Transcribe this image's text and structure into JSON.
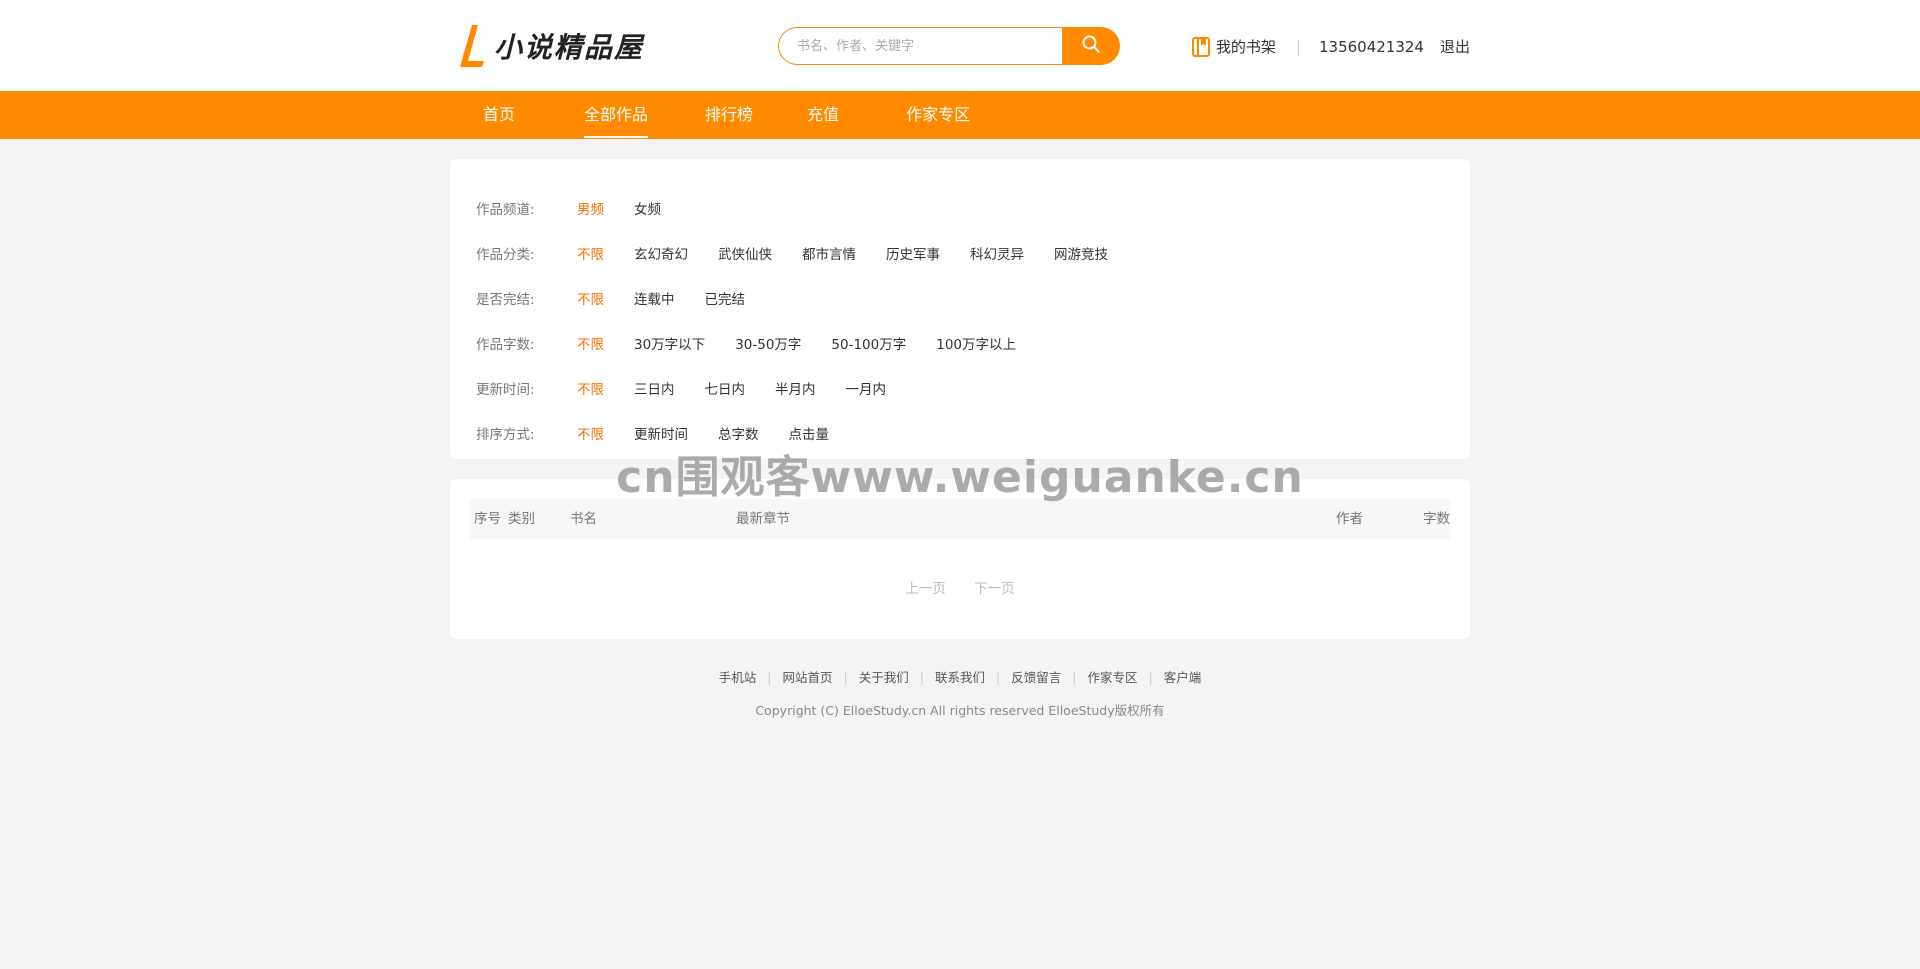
{
  "header": {
    "logo_text": "小说精品屋",
    "search_placeholder": "书名、作者、关键字",
    "bookshelf_label": "我的书架",
    "separator": "|",
    "phone": "13560421324",
    "logout_label": "退出"
  },
  "nav": {
    "items": [
      "首页",
      "全部作品",
      "排行榜",
      "充值",
      "作家专区"
    ],
    "active": "全部作品"
  },
  "filters": [
    {
      "label": "作品频道:",
      "options": [
        "男频",
        "女频"
      ],
      "selected": "男频"
    },
    {
      "label": "作品分类:",
      "options": [
        "不限",
        "玄幻奇幻",
        "武侠仙侠",
        "都市言情",
        "历史军事",
        "科幻灵异",
        "网游竞技"
      ],
      "selected": "不限"
    },
    {
      "label": "是否完结:",
      "options": [
        "不限",
        "连载中",
        "已完结"
      ],
      "selected": "不限"
    },
    {
      "label": "作品字数:",
      "options": [
        "不限",
        "30万字以下",
        "30-50万字",
        "50-100万字",
        "100万字以上"
      ],
      "selected": "不限"
    },
    {
      "label": "更新时间:",
      "options": [
        "不限",
        "三日内",
        "七日内",
        "半月内",
        "一月内"
      ],
      "selected": "不限"
    },
    {
      "label": "排序方式:",
      "options": [
        "不限",
        "更新时间",
        "总字数",
        "点击量"
      ],
      "selected": "不限"
    }
  ],
  "table": {
    "columns": {
      "index": "序号",
      "category": "类别",
      "title": "书名",
      "latest_chapter": "最新章节",
      "author": "作者",
      "word_count": "字数"
    },
    "rows": []
  },
  "pager": {
    "prev": "上一页",
    "next": "下一页"
  },
  "watermark": "cn围观客www.weiguanke.cn",
  "footer": {
    "links": [
      "手机站",
      "网站首页",
      "关于我们",
      "联系我们",
      "反馈留言",
      "作家专区",
      "客户端"
    ],
    "copyright": "Copyright (C) ElloeStudy.cn All rights reserved  ElloeStudy版权所有"
  },
  "colors": {
    "accent": "#ff8a00",
    "selected_text": "#ff6d00",
    "page_bg": "#f4f4f4"
  }
}
